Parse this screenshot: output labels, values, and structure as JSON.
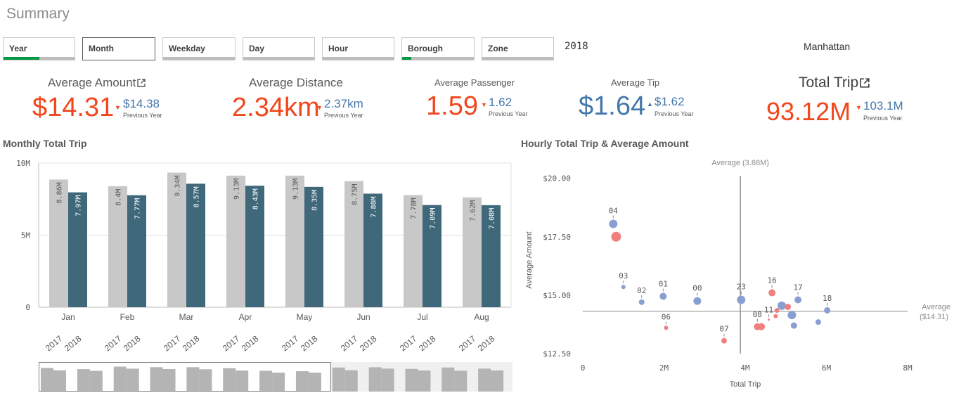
{
  "page": {
    "title": "Summary"
  },
  "filters": [
    {
      "label": "Year",
      "fill_fraction": 0.5
    },
    {
      "label": "Month",
      "active": true
    },
    {
      "label": "Weekday"
    },
    {
      "label": "Day"
    },
    {
      "label": "Hour"
    },
    {
      "label": "Borough",
      "fill_fraction": 0.13
    },
    {
      "label": "Zone"
    }
  ],
  "selections": {
    "year": "2018",
    "borough": "Manhattan"
  },
  "kpis": {
    "avg_amount": {
      "title": "Average Amount",
      "value": "$14.31",
      "prev": "$14.38",
      "prev_label": "Previous Year",
      "trend": "down"
    },
    "avg_distance": {
      "title": "Average Distance",
      "value": "2.34km",
      "prev": "2.37km",
      "prev_label": "Previous Year",
      "trend": "down"
    },
    "avg_passenger": {
      "title": "Average Passenger",
      "value": "1.59",
      "prev": "1.62",
      "prev_label": "Previous Year",
      "trend": "down"
    },
    "avg_tip": {
      "title": "Average Tip",
      "value": "$1.64",
      "prev": "$1.62",
      "prev_label": "Previous Year",
      "trend": "up"
    },
    "total_trip": {
      "title": "Total Trip",
      "value": "93.12M",
      "prev": "103.1M",
      "prev_label": "Previous Year",
      "trend": "down"
    }
  },
  "colors": {
    "accent_red": "#f1471d",
    "accent_blue": "#4477aa",
    "bar_2017": "#c8c8c8",
    "bar_2018": "#3f687b",
    "dot_blue": "#8a9fd1",
    "dot_red": "#f08080",
    "filter_green": "#009845"
  },
  "chart_data": [
    {
      "type": "bar",
      "title": "Monthly Total Trip",
      "categories": [
        "Jan",
        "Feb",
        "Mar",
        "Apr",
        "May",
        "Jun",
        "Jul",
        "Aug"
      ],
      "series": [
        {
          "name": "2017",
          "values": [
            8.86,
            8.4,
            9.34,
            9.13,
            9.13,
            8.75,
            7.78,
            7.62
          ],
          "labels": [
            "8.86M",
            "8.4M",
            "9.34M",
            "9.13M",
            "9.13M",
            "8.75M",
            "7.78M",
            "7.62M"
          ]
        },
        {
          "name": "2018",
          "values": [
            7.97,
            7.77,
            8.57,
            8.43,
            8.35,
            7.88,
            7.09,
            7.08
          ],
          "labels": [
            "7.97M",
            "7.77M",
            "8.57M",
            "8.43M",
            "8.35M",
            "7.88M",
            "7.09M",
            "7.08M"
          ]
        }
      ],
      "ylim": [
        0,
        10
      ],
      "yticks": [
        {
          "value": 10,
          "label": "10M"
        },
        {
          "value": 5,
          "label": "5M"
        },
        {
          "value": 0,
          "label": "0"
        }
      ],
      "grid": true,
      "minimap": {
        "visible_months": 8,
        "values": [
          [
            8.86,
            7.97
          ],
          [
            8.4,
            7.77
          ],
          [
            9.34,
            8.57
          ],
          [
            9.13,
            8.43
          ],
          [
            9.13,
            8.35
          ],
          [
            8.75,
            7.88
          ],
          [
            7.78,
            7.09
          ],
          [
            7.62,
            7.08
          ],
          [
            9.0,
            8.0
          ],
          [
            9.1,
            8.6
          ],
          [
            8.5,
            7.9
          ],
          [
            9.0,
            7.8
          ],
          [
            8.6,
            7.9
          ]
        ]
      }
    },
    {
      "type": "scatter",
      "title": "Hourly Total Trip & Average Amount",
      "xlabel": "Total Trip",
      "ylabel": "Average Amount",
      "xlim": [
        0,
        8
      ],
      "ylim": [
        12.5,
        20.5
      ],
      "xticks": [
        {
          "value": 0,
          "label": "0"
        },
        {
          "value": 2,
          "label": "2M"
        },
        {
          "value": 4,
          "label": "4M"
        },
        {
          "value": 6,
          "label": "6M"
        },
        {
          "value": 8,
          "label": "8M"
        }
      ],
      "yticks": [
        {
          "value": 20,
          "label": "$20.00"
        },
        {
          "value": 17.5,
          "label": "$17.50"
        },
        {
          "value": 15,
          "label": "$15.00"
        },
        {
          "value": 12.5,
          "label": "$12.50"
        }
      ],
      "reference_lines": [
        {
          "axis": "x",
          "value": 3.88,
          "label": "Average (3.88M)"
        },
        {
          "axis": "y",
          "value": 14.31,
          "label": "Average",
          "sublabel": "($14.31)"
        }
      ],
      "points": [
        {
          "label": "04",
          "x": 0.75,
          "y": 18.05,
          "size": 6,
          "color": "blue"
        },
        {
          "label": "",
          "x": 0.82,
          "y": 17.5,
          "size": 7,
          "color": "red"
        },
        {
          "label": "03",
          "x": 1.0,
          "y": 15.35,
          "size": 3,
          "color": "blue"
        },
        {
          "label": "02",
          "x": 1.45,
          "y": 14.7,
          "size": 4,
          "color": "blue"
        },
        {
          "label": "01",
          "x": 1.98,
          "y": 14.95,
          "size": 5,
          "color": "blue"
        },
        {
          "label": "06",
          "x": 2.05,
          "y": 13.6,
          "size": 3,
          "color": "red"
        },
        {
          "label": "00",
          "x": 2.82,
          "y": 14.75,
          "size": 5.5,
          "color": "blue"
        },
        {
          "label": "07",
          "x": 3.48,
          "y": 13.05,
          "size": 4,
          "color": "red"
        },
        {
          "label": "23",
          "x": 3.9,
          "y": 14.8,
          "size": 6,
          "color": "blue"
        },
        {
          "label": "08",
          "x": 4.3,
          "y": 13.65,
          "size": 5,
          "color": "red"
        },
        {
          "label": "",
          "x": 4.4,
          "y": 13.65,
          "size": 5,
          "color": "red"
        },
        {
          "label": "11",
          "x": 4.58,
          "y": 13.95,
          "size": 1.5,
          "color": "red"
        },
        {
          "label": "",
          "x": 4.75,
          "y": 14.1,
          "size": 3,
          "color": "red"
        },
        {
          "label": "",
          "x": 4.78,
          "y": 14.35,
          "size": 3.5,
          "color": "red"
        },
        {
          "label": "16",
          "x": 4.66,
          "y": 15.1,
          "size": 5,
          "color": "red"
        },
        {
          "label": "",
          "x": 4.9,
          "y": 14.55,
          "size": 6,
          "color": "blue"
        },
        {
          "label": "",
          "x": 5.05,
          "y": 14.5,
          "size": 4.5,
          "color": "red"
        },
        {
          "label": "",
          "x": 5.15,
          "y": 14.15,
          "size": 6,
          "color": "blue"
        },
        {
          "label": "",
          "x": 5.2,
          "y": 13.7,
          "size": 4.5,
          "color": "blue"
        },
        {
          "label": "17",
          "x": 5.3,
          "y": 14.8,
          "size": 5,
          "color": "blue"
        },
        {
          "label": "",
          "x": 5.8,
          "y": 13.85,
          "size": 4,
          "color": "blue"
        },
        {
          "label": "18",
          "x": 6.02,
          "y": 14.35,
          "size": 4.5,
          "color": "blue"
        }
      ]
    }
  ]
}
